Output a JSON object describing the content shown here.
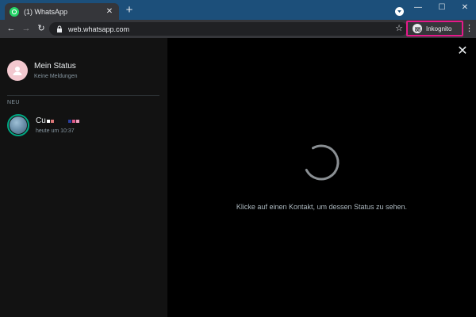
{
  "browser": {
    "tab": {
      "title": "(1) WhatsApp",
      "favicon": "whatsapp-icon"
    },
    "url": "web.whatsapp.com",
    "incognito_label": "Inkognito",
    "colors": {
      "tabbar": "#1c4f7a",
      "toolbar": "#35363a",
      "incognito_highlight": "#e5198a"
    }
  },
  "sidebar": {
    "my_status": {
      "title": "Mein Status",
      "subtitle": "Keine Meldungen"
    },
    "section_label": "NEU",
    "contacts": [
      {
        "name": "Cu",
        "time": "heute um 10:37"
      }
    ]
  },
  "main": {
    "message": "Klicke auf einen Kontakt, um dessen Status zu sehen."
  },
  "colors": {
    "accent": "#00a884",
    "background": "#000000",
    "sidebar": "#121212"
  }
}
